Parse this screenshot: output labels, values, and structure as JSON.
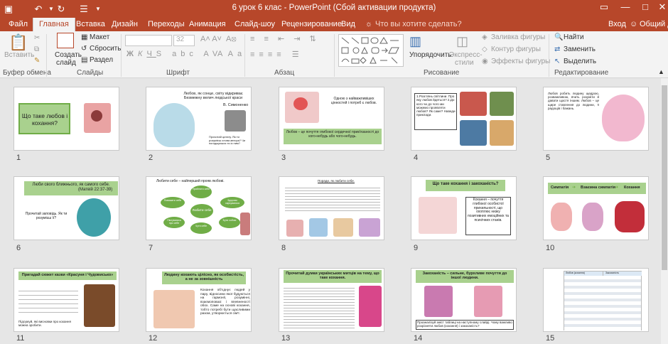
{
  "window": {
    "title": "6 урок 6 клас - PowerPoint (Сбой активации продукта)"
  },
  "tabs": [
    {
      "label": "Файл"
    },
    {
      "label": "Главная"
    },
    {
      "label": "Вставка"
    },
    {
      "label": "Дизайн"
    },
    {
      "label": "Переходы"
    },
    {
      "label": "Анимация"
    },
    {
      "label": "Слайд-шоу"
    },
    {
      "label": "Рецензирование"
    },
    {
      "label": "Вид"
    }
  ],
  "tellme": "Что вы хотите сделать?",
  "account": {
    "signin": "Вход",
    "share": "Общий д"
  },
  "ribbon": {
    "clipboard": {
      "paste": "Вставить",
      "group": "Буфер обмена"
    },
    "slides": {
      "new": "Создать",
      "new2": "слайд",
      "layout": "Макет",
      "reset": "Сбросить",
      "section": "Раздел",
      "group": "Слайды"
    },
    "font": {
      "size": "32",
      "group": "Шрифт"
    },
    "paragraph": {
      "group": "Абзац"
    },
    "drawing": {
      "arrange": "Упорядочить",
      "quick1": "Экспресс-",
      "quick2": "стили",
      "fill": "Заливка фигуры",
      "outline": "Контур фигуры",
      "effects": "Эффекты фигуры",
      "group": "Рисование"
    },
    "editing": {
      "find": "Найти",
      "replace": "Заменить",
      "select": "Выделить",
      "group": "Редактирование"
    }
  },
  "slides": [
    {
      "n": "1",
      "title": "Що таке любов і кохання?"
    },
    {
      "n": "2",
      "quote": "Любов, як сонце, світу відкриває Безмежну велич людської краси",
      "author": "В. Симоненко",
      "caption": "Прочитай цитату. Як ти розумієш слова автора? Чи погоджуєшся ти із ним?"
    },
    {
      "n": "3",
      "text": "Одною з найважливіших цінностей і потреб є любов.",
      "def": "Любов – це почуття глибокої сердечної прив'язаності до кого-небудь або чого-небудь."
    },
    {
      "n": "4",
      "text": "1.Розглянь світлини. Про яку любов йдеться? 2.До кого чи до чого ми можемо проявляти любов? Як саме? Наведи приклади."
    },
    {
      "n": "5",
      "text": "Любов робить людину щедрою, розважливою, вчить розуміти й давати щастя іншим. Любов – це щире ставлення до людини, її радощів і бажань."
    },
    {
      "n": "6",
      "title": "Люби свого ближнього, як самого себе.",
      "ref": "(Матвій 22:37-39)",
      "q": "Прочитай заповідь. Як ти розумієш її?"
    },
    {
      "n": "7",
      "title": "Любити себе – найперший прояв любові.",
      "center": "Любити себе",
      "petals": [
        "Прийняти себе",
        "Поважати себе",
        "Здорово харчуватися",
        "Бути собою",
        "Чути себе",
        "Піклуватися про себе"
      ]
    },
    {
      "n": "8",
      "title": "Поради, як любити себе."
    },
    {
      "n": "9",
      "title": "Що таке кохання і закоханість?",
      "def": "Кохання – почуття глибокої особистої прихильності, що охоплює низку позитивних емоційних та психічних станів."
    },
    {
      "n": "10",
      "title": "Симпатія",
      "mid": "Взаємна симпатія",
      "end": "Кохання"
    },
    {
      "n": "11",
      "title": "Пригадай сюжет казки «Красуня і Чудовисько»",
      "note": "Підсумуй, які висновки про кохання можна зробити."
    },
    {
      "n": "12",
      "title": "Людину кохають цілісно, як особистість, а не за зовнішність",
      "text": "Кохання об'єднує людей у пару, відносини якої будуються на гармонії, розумінні, взаємоповазі і впевненості обох. Саме на основі кохання, тобто потребі бути щасливими разом, утворюється сім'ї."
    },
    {
      "n": "13",
      "title": "Прочитай думки українських митців на тему, що таке кохання."
    },
    {
      "n": "14",
      "title": "Закоханість – сильне, бурхливе почуття до іншої людини.",
      "task": "Проаналізуй зміст таблиці на наступному слайді. Чому важливо розрізняти любов (кохання) і закоханість?"
    },
    {
      "n": "15",
      "col1": "Любов (кохання)",
      "col2": "Закоханість"
    }
  ],
  "colors": {
    "accent": "#b7472a",
    "green": "#a9d18e",
    "green_title": "#70ad47"
  },
  "icons": [
    "undo-icon",
    "redo-icon",
    "save-icon",
    "customize-icon",
    "minimize-icon",
    "restore-icon",
    "close-icon",
    "search-icon",
    "user-icon",
    "paste-icon",
    "cut-icon",
    "copy-icon",
    "format-painter-icon",
    "new-slide-icon",
    "shapes-icon",
    "find-icon",
    "replace-icon",
    "select-icon"
  ]
}
